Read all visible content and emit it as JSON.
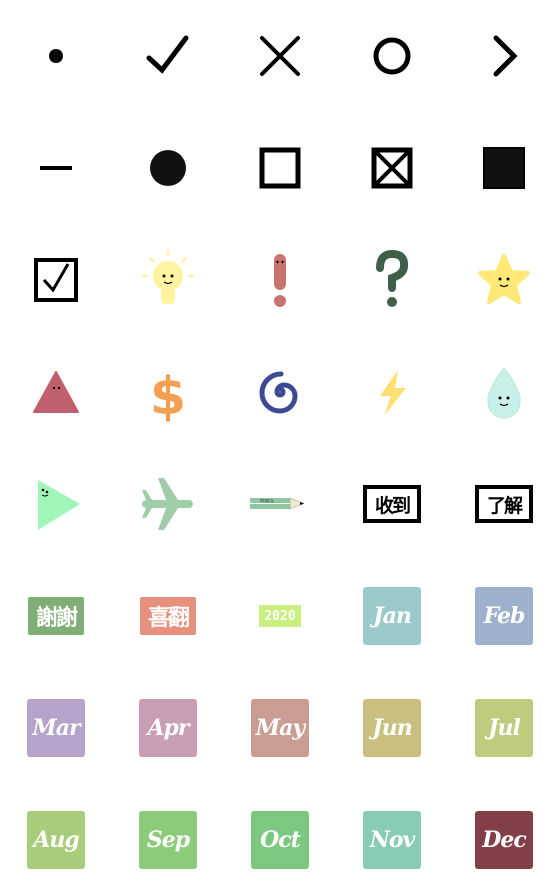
{
  "items": [
    {
      "type": "dot",
      "name": "dot-icon"
    },
    {
      "type": "check",
      "name": "check-icon"
    },
    {
      "type": "cross",
      "name": "cross-icon"
    },
    {
      "type": "circle",
      "name": "circle-icon"
    },
    {
      "type": "chevron",
      "name": "chevron-right-icon"
    },
    {
      "type": "dash",
      "name": "dash-icon"
    },
    {
      "type": "disc",
      "name": "filled-circle-icon"
    },
    {
      "type": "square",
      "name": "empty-square-icon"
    },
    {
      "type": "xbox",
      "name": "crossed-box-icon"
    },
    {
      "type": "fsquare",
      "name": "filled-square-icon"
    },
    {
      "type": "checkbox",
      "name": "checked-box-icon"
    },
    {
      "type": "bulb",
      "name": "lightbulb-icon",
      "color": "#fdf3a0"
    },
    {
      "type": "exclaim",
      "name": "exclamation-icon",
      "color": "#c9736e"
    },
    {
      "type": "question",
      "name": "question-icon",
      "color": "#3e6048"
    },
    {
      "type": "star",
      "name": "star-icon",
      "color": "#fde878"
    },
    {
      "type": "triangle",
      "name": "triangle-icon",
      "color": "#c0606e"
    },
    {
      "type": "dollar",
      "name": "dollar-icon",
      "color": "#f5a050"
    },
    {
      "type": "spiral",
      "name": "spiral-icon",
      "color": "#3c4a94"
    },
    {
      "type": "bolt",
      "name": "lightning-icon",
      "color": "#fde070"
    },
    {
      "type": "drop",
      "name": "droplet-icon",
      "color": "#c8efe8"
    },
    {
      "type": "play",
      "name": "play-icon",
      "color": "#a0f5b8"
    },
    {
      "type": "plane",
      "name": "airplane-icon",
      "color": "#a0cca8"
    },
    {
      "type": "pencil",
      "name": "pencil-icon",
      "color": "#8fc8a0",
      "label": "PENCIL"
    },
    {
      "type": "stamp-black",
      "name": "stamp-received",
      "label": "收到"
    },
    {
      "type": "stamp-black",
      "name": "stamp-understood",
      "label": "了解"
    },
    {
      "type": "stamp-color",
      "name": "stamp-thanks",
      "label": "謝謝",
      "color": "#7fae76"
    },
    {
      "type": "stamp-color",
      "name": "stamp-happy",
      "label": "喜翻",
      "color": "#e8907e"
    },
    {
      "type": "stamp-year",
      "name": "stamp-year",
      "label": "2020",
      "color": "#c9f07f"
    },
    {
      "type": "month",
      "name": "month-jan",
      "label": "Jan",
      "color": "#9ccaca"
    },
    {
      "type": "month",
      "name": "month-feb",
      "label": "Feb",
      "color": "#9fb0cc"
    },
    {
      "type": "month",
      "name": "month-mar",
      "label": "Mar",
      "color": "#b6a3c9"
    },
    {
      "type": "month",
      "name": "month-apr",
      "label": "Apr",
      "color": "#c89eb5"
    },
    {
      "type": "month",
      "name": "month-may",
      "label": "May",
      "color": "#c99c94"
    },
    {
      "type": "month",
      "name": "month-jun",
      "label": "Jun",
      "color": "#c9c07f"
    },
    {
      "type": "month",
      "name": "month-jul",
      "label": "Jul",
      "color": "#bfcb7d"
    },
    {
      "type": "month",
      "name": "month-aug",
      "label": "Aug",
      "color": "#a9cc7a"
    },
    {
      "type": "month",
      "name": "month-sep",
      "label": "Sep",
      "color": "#8ccb7a"
    },
    {
      "type": "month",
      "name": "month-oct",
      "label": "Oct",
      "color": "#7dc880"
    },
    {
      "type": "month",
      "name": "month-nov",
      "label": "Nov",
      "color": "#8acbb5"
    },
    {
      "type": "month",
      "name": "month-dec",
      "label": "Dec",
      "color": "#833f48"
    }
  ]
}
